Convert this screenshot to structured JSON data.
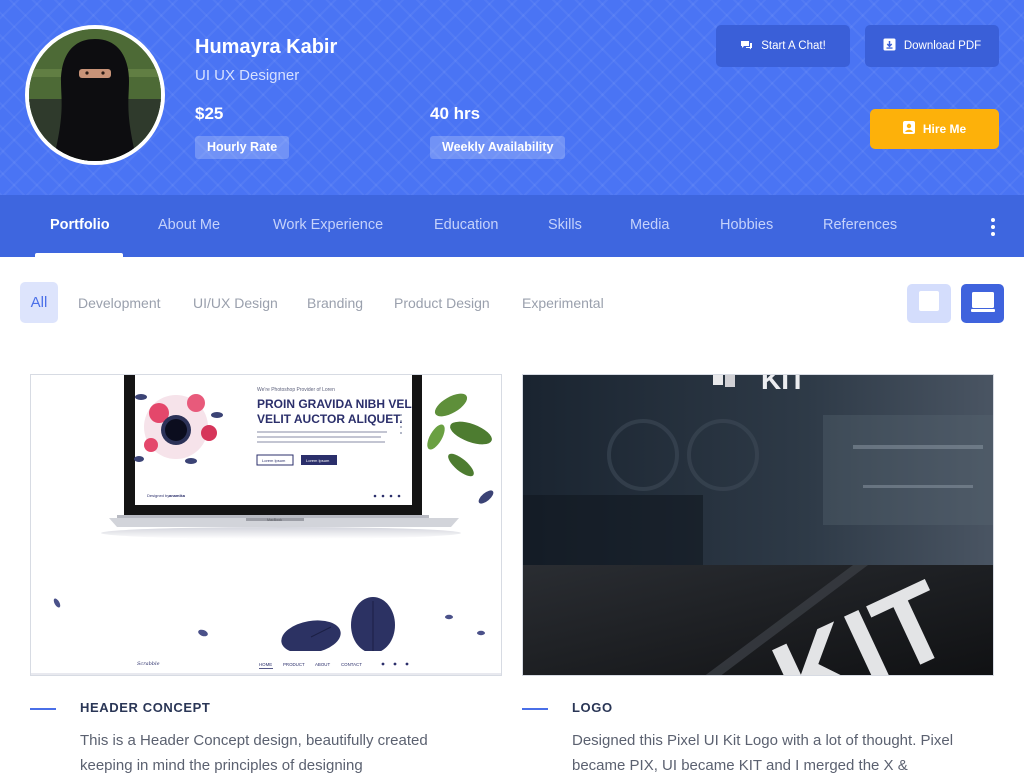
{
  "profile": {
    "name": "Humayra Kabir",
    "role": "UI UX Designer",
    "rate_value": "$25",
    "rate_label": "Hourly Rate",
    "availability_value": "40 hrs",
    "availability_label": "Weekly Availability"
  },
  "actions": {
    "chat_label": "Start A Chat!",
    "pdf_label": "Download PDF",
    "hire_label": "Hire Me",
    "chat_icon": "chat-icon",
    "pdf_icon": "download-icon",
    "hire_icon": "user-icon"
  },
  "nav": {
    "items": [
      {
        "label": "Portfolio",
        "active": true
      },
      {
        "label": "About Me"
      },
      {
        "label": "Work Experience"
      },
      {
        "label": "Education"
      },
      {
        "label": "Skills"
      },
      {
        "label": "Media"
      },
      {
        "label": "Hobbies"
      },
      {
        "label": "References"
      }
    ],
    "more_icon": "kebab-menu-icon"
  },
  "filters": {
    "items": [
      "All",
      "Development",
      "UI/UX Design",
      "Branding",
      "Product Design",
      "Experimental"
    ],
    "active": "All"
  },
  "view_toggle": {
    "options": [
      "grid-view-icon",
      "list-view-icon"
    ],
    "active": "list-view-icon"
  },
  "projects": [
    {
      "title": "HEADER CONCEPT",
      "description": "This is a Header Concept design, beautifully created keeping in mind the principles of designing",
      "mockup": {
        "headline_1": "PROIN GRAVIDA NIBH VEL",
        "headline_2": "VELIT AUCTOR ALIQUET.",
        "kicker": "We're Photoshop Provider of Loren",
        "button_1": "Lorem Ipsum",
        "button_2": "Lorem Ipsum",
        "designed_by": "Designed by",
        "designer": "anamika",
        "laptop_brand": "MacBook",
        "brand": "Scrabble",
        "menu": [
          "HOME",
          "PRODUCT",
          "ABOUT",
          "CONTACT"
        ]
      }
    },
    {
      "title": "LOGO",
      "description": "Designed this Pixel UI Kit Logo with a lot of thought. Pixel became PIX, UI became KIT and I merged the X &",
      "mockup": {
        "wall_text": "KIT",
        "sign_text": "KIT"
      }
    }
  ],
  "colors": {
    "hero_blue": "#4a74f4",
    "nav_blue": "#3e66df",
    "button_blue": "#3a5fd8",
    "hire_yellow": "#fdb10a",
    "accent": "#4a6fe8"
  }
}
